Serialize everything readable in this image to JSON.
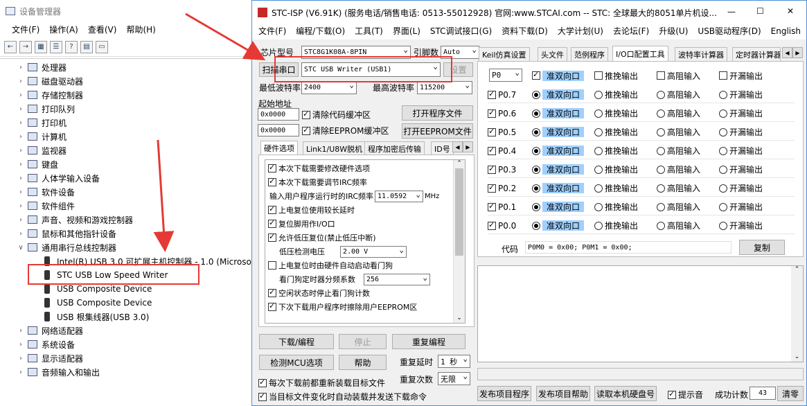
{
  "device_manager": {
    "title": "设备管理器",
    "menu": [
      "文件(F)",
      "操作(A)",
      "查看(V)",
      "帮助(H)"
    ],
    "tree": [
      {
        "label": "处理器",
        "expanded": false
      },
      {
        "label": "磁盘驱动器",
        "expanded": false
      },
      {
        "label": "存储控制器",
        "expanded": false
      },
      {
        "label": "打印队列",
        "expanded": false
      },
      {
        "label": "打印机",
        "expanded": false
      },
      {
        "label": "计算机",
        "expanded": false
      },
      {
        "label": "监视器",
        "expanded": false
      },
      {
        "label": "键盘",
        "expanded": false
      },
      {
        "label": "人体学输入设备",
        "expanded": false
      },
      {
        "label": "软件设备",
        "expanded": false
      },
      {
        "label": "软件组件",
        "expanded": false
      },
      {
        "label": "声音、视频和游戏控制器",
        "expanded": false
      },
      {
        "label": "鼠标和其他指针设备",
        "expanded": false
      },
      {
        "label": "通用串行总线控制器",
        "expanded": true
      }
    ],
    "usb_children": [
      "Intel(R) USB 3.0 可扩展主机控制器 - 1.0 (Microsof",
      "STC USB Low Speed Writer",
      "USB Composite Device",
      "USB Composite Device",
      "USB 根集线器(USB 3.0)"
    ],
    "tree_after": [
      "网络适配器",
      "系统设备",
      "显示适配器",
      "音频输入和输出"
    ]
  },
  "stc": {
    "title": "STC-ISP (V6.91K) (服务电话/销售电话: 0513-55012928) 官网:www.STCAI.com  -- STC: 全球最大的8051单片机设...",
    "window_controls": [
      "—",
      "☐",
      "✕"
    ],
    "menu": [
      "文件(F)",
      "编程/下载(O)",
      "工具(T)",
      "界面(L)",
      "STC调试接口(G)",
      "资料下载(D)",
      "大学计划(U)",
      "去论坛(F)",
      "升级(U)",
      "USB驱动程序(D)",
      "English"
    ],
    "chip_label": "芯片型号",
    "chip_value": "STC8G1K08A-8PIN",
    "pins_label": "引脚数",
    "pins_value": "Auto",
    "scan_label": "扫描串口",
    "port_value": "STC USB Writer (USB1)",
    "settings_label": "设置",
    "min_baud_label": "最低波特率",
    "min_baud_value": "2400",
    "max_baud_label": "最高波特率",
    "max_baud_value": "115200",
    "start_addr_label": "起始地址",
    "addr1": "0x0000",
    "clear_code": "清除代码缓冲区",
    "open_prog": "打开程序文件",
    "addr2": "0x0000",
    "clear_eeprom": "清除EEPROM缓冲区",
    "open_eeprom": "打开EEPROM文件",
    "left_tabs": [
      "硬件选项",
      "Link1/U8W脱机",
      "程序加密后传输",
      "ID号"
    ],
    "hw_options": [
      {
        "label": "本次下载需要修改硬件选项",
        "checked": true
      },
      {
        "label": "本次下载需要调节IRC频率",
        "checked": true
      },
      {
        "label": "输入用户程序运行时的IRC频率",
        "checked": null,
        "value": "11.0592",
        "unit": "MHz"
      },
      {
        "label": "上电复位使用较长延时",
        "checked": true
      },
      {
        "label": "复位脚用作I/O口",
        "checked": true
      },
      {
        "label": "允许低压复位(禁止低压中断)",
        "checked": true
      },
      {
        "label": "低压检测电压",
        "checked": null,
        "value": "2.00 V"
      },
      {
        "label": "上电复位时由硬件自动启动看门狗",
        "checked": false
      },
      {
        "label": "看门狗定时器分频系数",
        "checked": null,
        "value": "256"
      },
      {
        "label": "空闲状态时停止看门狗计数",
        "checked": true
      },
      {
        "label": "下次下载用户程序时擦除用户EEPROM区",
        "checked": true
      }
    ],
    "btn_download": "下载/编程",
    "btn_stop": "停止",
    "btn_reprog": "重复编程",
    "btn_check_mcu": "检测MCU选项",
    "btn_help": "帮助",
    "repeat_delay_label": "重复延时",
    "repeat_delay_value": "1 秒",
    "repeat_count_label": "重复次数",
    "repeat_count_value": "无限",
    "reload_each": "每次下载前都重新装载目标文件",
    "auto_reload": "当目标文件变化时自动装载并发送下载命令",
    "right_tabs": [
      "Keil仿真设置",
      "头文件",
      "范例程序",
      "I/O口配置工具",
      "波特率计算器",
      "定时器计算器"
    ],
    "port_select": "P0",
    "io_header": {
      "quasi": "准双向口",
      "pushpull": "推挽输出",
      "highz": "高阻输入",
      "opendrain": "开漏输出"
    },
    "io_pins": [
      "P0.7",
      "P0.6",
      "P0.5",
      "P0.4",
      "P0.3",
      "P0.2",
      "P0.1",
      "P0.0"
    ],
    "code_label": "代码",
    "code_value": "P0M0 = 0x00; P0M1 = 0x00;",
    "copy_label": "复制",
    "btn_publish": "发布项目程序",
    "btn_publish_help": "发布项目帮助",
    "btn_read_disk": "读取本机硬盘号",
    "sound_label": "提示音",
    "success_label": "成功计数",
    "success_value": "43",
    "clear_label": "清零"
  },
  "colors": {
    "highlight_box": "#e53935",
    "arrow": "#e53935",
    "io_highlight": "#9fd0ff"
  }
}
